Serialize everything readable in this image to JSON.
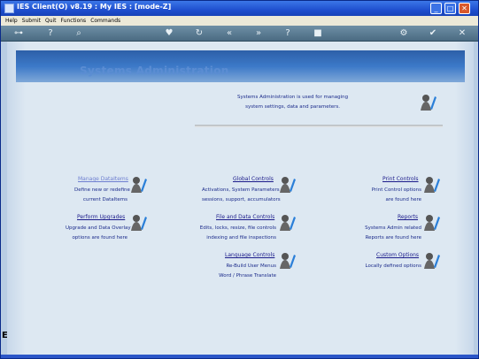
{
  "window": {
    "title": "IES Client(O) v8.19 : My IES :     [mode-Z]"
  },
  "menu": [
    "Help",
    "Submit",
    "Quit",
    "Functions",
    "Commands"
  ],
  "banner": {
    "title": "Systems Administration"
  },
  "intro": {
    "line1": "Systems Administration is used for managing",
    "line2": "system settings, data and parameters."
  },
  "sections": {
    "manage_dataitems": {
      "label": "Manage DataItems",
      "line1": "Define new or redefine",
      "line2": "current DataItems"
    },
    "global_controls": {
      "label": "Global Controls",
      "line1": "Activations, System Parameters",
      "line2": "sessions, support, accumulators"
    },
    "print_controls": {
      "label": "Print Controls",
      "line1": "Print Control options",
      "line2": "are found here"
    },
    "perform_upgrades": {
      "label": "Perform Upgrades",
      "line1": "Upgrade and Data Overlay",
      "line2": "options are found here"
    },
    "file_data_controls": {
      "label": "File and Data Controls",
      "line1": "Edits, locks, resize, file controls",
      "line2": "indexing and file inspections"
    },
    "reports": {
      "label": "Reports",
      "line1": "Systems Admin related",
      "line2": "Reports are found here"
    },
    "language_controls": {
      "label": "Language Controls",
      "line1": "Re-Build User Menus",
      "line2": "Word / Phrase Translate"
    },
    "custom_options": {
      "label": "Custom Options",
      "line1": "Locally defined options",
      "line2": ""
    }
  },
  "left_strip_letter": "E",
  "colors": {
    "titlebar": "#1f4fcf",
    "banner": "#3c79c8",
    "content": "#dde8f2",
    "link": "#1a1a8a",
    "accent_icon": "#2b7fd8"
  }
}
